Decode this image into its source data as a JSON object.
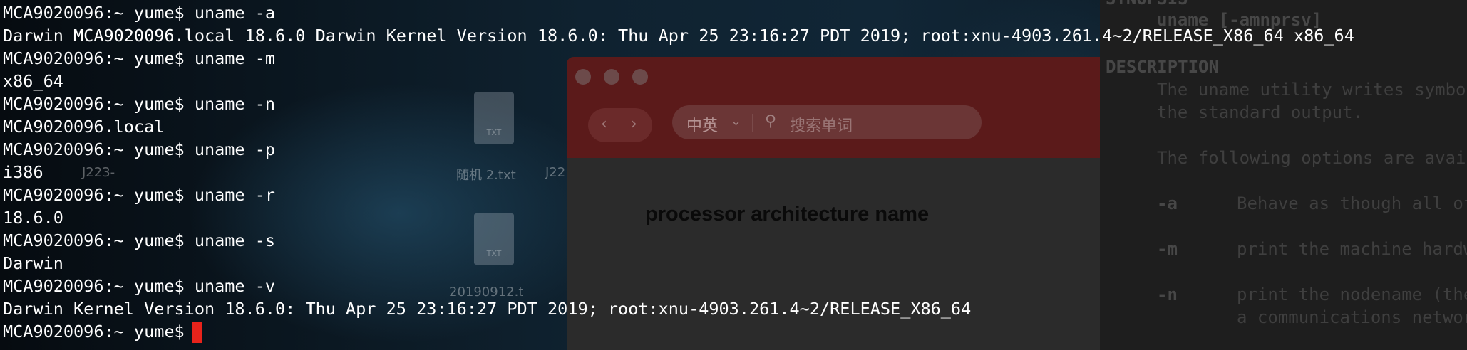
{
  "terminal": {
    "lines": [
      "MCA9020096:~ yume$ uname -a",
      "Darwin MCA9020096.local 18.6.0 Darwin Kernel Version 18.6.0: Thu Apr 25 23:16:27 PDT 2019; root:xnu-4903.261.4~2/RELEASE_X86_64 x86_64",
      "MCA9020096:~ yume$ uname -m",
      "x86_64",
      "MCA9020096:~ yume$ uname -n",
      "MCA9020096.local",
      "MCA9020096:~ yume$ uname -p",
      "i386",
      "MCA9020096:~ yume$ uname -r",
      "18.6.0",
      "MCA9020096:~ yume$ uname -s",
      "Darwin",
      "MCA9020096:~ yume$ uname -v",
      "Darwin Kernel Version 18.6.0: Thu Apr 25 23:16:27 PDT 2019; root:xnu-4903.261.4~2/RELEASE_X86_64",
      "MCA9020096:~ yume$ "
    ],
    "cursor_color": "#e8231b"
  },
  "desktop": {
    "icons": [
      {
        "label": "随机 2.txt",
        "ext": "TXT"
      },
      {
        "label": "20190912.t",
        "ext": "TXT"
      },
      {
        "label": "J223-",
        "ext": ""
      },
      {
        "label": "J22",
        "ext": ""
      }
    ]
  },
  "dictionary": {
    "lang_selector": "中英",
    "search_placeholder": "搜索单词",
    "back_icon": "chevron-left-icon",
    "forward_icon": "chevron-right-icon",
    "heading": "processor architecture name"
  },
  "manpage": {
    "synopsis_header": "SYNOPSIS",
    "synopsis": "uname [-amnprsv]",
    "description_header": "DESCRIPTION",
    "desc1": "The uname utility writes symbol",
    "desc2": "the standard output.",
    "desc3": "The following options are avail",
    "opt_a": "-a",
    "opt_a_text": "Behave as though all of",
    "opt_m": "-m",
    "opt_m_text": "print the machine hardw",
    "opt_n": "-n",
    "opt_n_text": "print the nodename (the",
    "opt_n_text2": "a communications networ"
  }
}
